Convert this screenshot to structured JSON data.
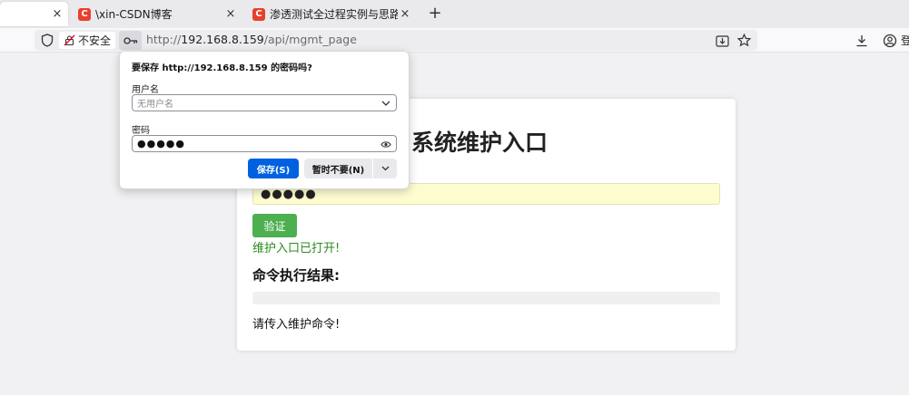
{
  "tabs": [
    {
      "title": "",
      "active": true
    },
    {
      "title": "\\xin-CSDN博客",
      "favicon": "C",
      "active": false
    },
    {
      "title": "渗透测试全过程实例与思路-CSI",
      "favicon": "C",
      "active": false
    }
  ],
  "tab_close_glyph": "×",
  "new_tab_glyph": "+",
  "navbar": {
    "security_label": "不安全",
    "url_prefix": "http://",
    "url_host": "192.168.8.159",
    "url_path": "/api/mgmt_page",
    "account_label": "登"
  },
  "page": {
    "title": "系统维护入口",
    "password_value": "●●●●●",
    "verify_button": "验证",
    "status_message": "维护入口已打开!",
    "result_heading": "命令执行结果:",
    "hint": "请传入维护命令!"
  },
  "password_popup": {
    "title": "要保存 http://192.168.8.159 的密码吗?",
    "username_label": "用户名",
    "username_placeholder": "无用户名",
    "password_label": "密码",
    "password_value": "●●●●●",
    "save_button": "保存(S)",
    "not_now_button": "暂时不要(N)"
  },
  "colors": {
    "accent_blue": "#0061e0",
    "verify_green": "#4caf50",
    "status_green": "#2e8b20",
    "autofill_yellow": "#fefdd0",
    "csdn_red": "#e8402b"
  }
}
